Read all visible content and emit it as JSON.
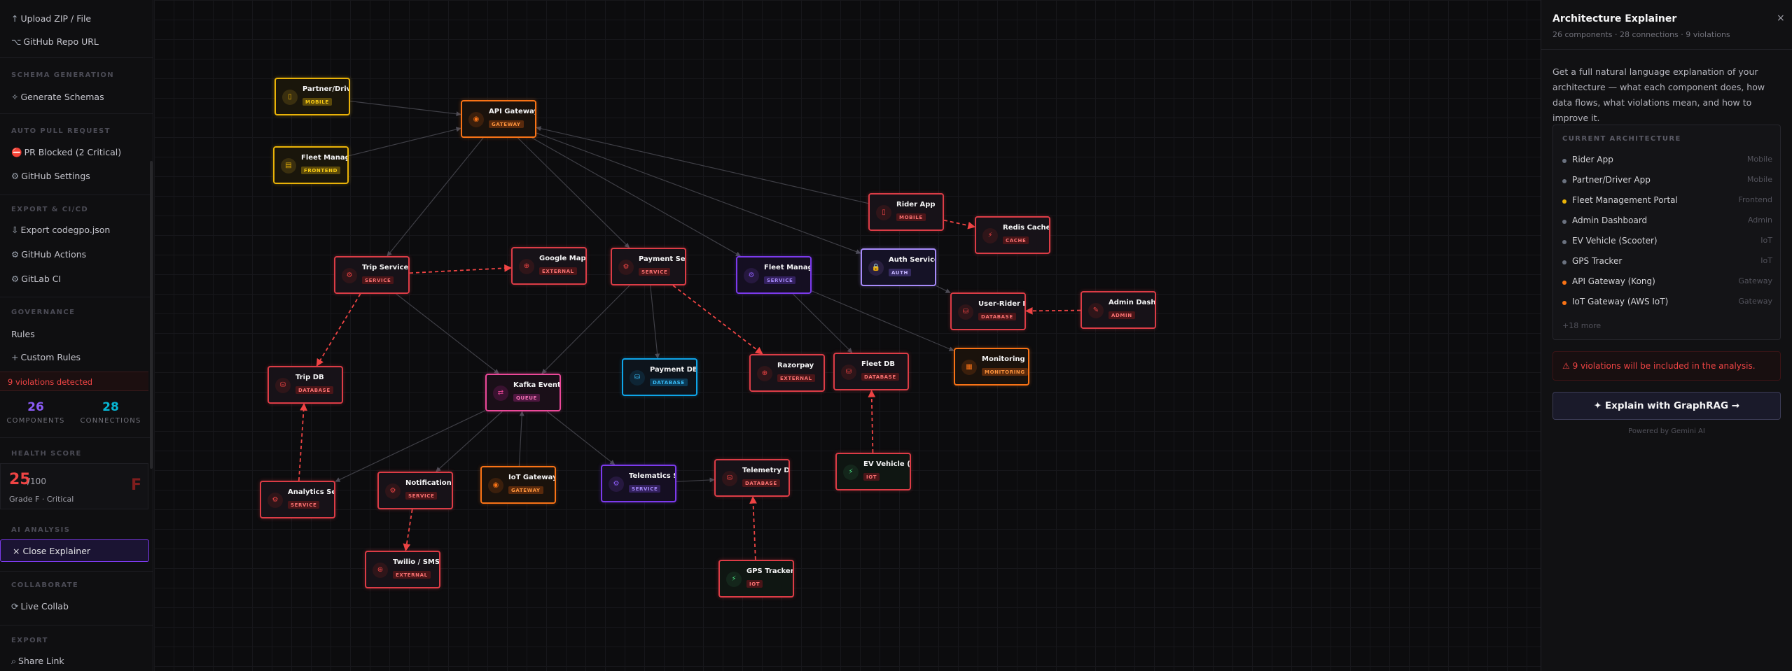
{
  "sidebar": {
    "items": {
      "upload": {
        "glyph": "↑",
        "label": "Upload ZIP / File"
      },
      "github_repo": {
        "glyph": "⌥",
        "label": "GitHub Repo URL"
      },
      "generate_schemas": {
        "glyph": "✧",
        "label": "Generate Schemas"
      },
      "pr_blocked": {
        "glyph": "⛔",
        "label": "PR Blocked (2 Critical)"
      },
      "github_settings": {
        "glyph": "⚙",
        "label": "GitHub Settings"
      },
      "export_json": {
        "glyph": "⇩",
        "label": "Export codegpo.json"
      },
      "github_actions": {
        "glyph": "⚙",
        "label": "GitHub Actions"
      },
      "gitlab_ci": {
        "glyph": "⚙",
        "label": "GitLab CI"
      },
      "rules": {
        "glyph": "",
        "label": "Rules"
      },
      "custom_rules": {
        "glyph": "+",
        "label": "Custom Rules"
      },
      "live_collab": {
        "glyph": "⟳",
        "label": "Live Collab"
      },
      "share_link": {
        "glyph": "⌕",
        "label": "Share Link"
      }
    },
    "sections": {
      "schema": "SCHEMA GENERATION",
      "auto_pr": "AUTO PULL REQUEST",
      "export_ci": "EXPORT & CI/CD",
      "governance": "GOVERNANCE",
      "health": "HEALTH SCORE",
      "ai": "AI ANALYSIS",
      "collab": "COLLABORATE",
      "export": "EXPORT"
    },
    "violations_text": "9 violations detected",
    "stats": {
      "components_value": "26",
      "components_label": "COMPONENTS",
      "connections_value": "28",
      "connections_label": "CONNECTIONS"
    },
    "health": {
      "score": "25",
      "of": "/100",
      "grade": "Grade F · Critical",
      "letter": "F"
    },
    "close_explainer": "× Close Explainer"
  },
  "canvas": {
    "nodes": [
      {
        "id": "partner",
        "name": "Partner/Driver…",
        "tag": "MOBILE",
        "icon": "▯",
        "kind": "yellow"
      },
      {
        "id": "fleetportal",
        "name": "Fleet Managem",
        "tag": "FRONTEND",
        "icon": "▤",
        "kind": "yellow"
      },
      {
        "id": "apigw",
        "name": "API Gateway (K",
        "tag": "GATEWAY",
        "icon": "◉",
        "kind": "orange"
      },
      {
        "id": "rider",
        "name": "Rider App",
        "tag": "MOBILE",
        "icon": "▯",
        "kind": "red"
      },
      {
        "id": "redis",
        "name": "Redis Cache",
        "tag": "CACHE",
        "icon": "⚡",
        "kind": "red"
      },
      {
        "id": "trip",
        "name": "Trip Service",
        "tag": "SERVICE",
        "icon": "⚙",
        "kind": "red"
      },
      {
        "id": "gmaps",
        "name": "Google Maps A",
        "tag": "EXTERNAL",
        "icon": "⊕",
        "kind": "red"
      },
      {
        "id": "payment",
        "name": "Payment Servi",
        "tag": "SERVICE",
        "icon": "⚙",
        "kind": "red"
      },
      {
        "id": "fleetsvc",
        "name": "Fleet Managem",
        "tag": "SERVICE",
        "icon": "⚙",
        "kind": "purple"
      },
      {
        "id": "auth",
        "name": "Auth Service",
        "tag": "AUTH",
        "icon": "🔒",
        "kind": "violet"
      },
      {
        "id": "userdb",
        "name": "User-Rider DB",
        "tag": "DATABASE",
        "icon": "⛁",
        "kind": "red"
      },
      {
        "id": "admin",
        "name": "Admin Dashboa",
        "tag": "ADMIN",
        "icon": "✎",
        "kind": "red"
      },
      {
        "id": "tripdb",
        "name": "Trip DB",
        "tag": "DATABASE",
        "icon": "⛁",
        "kind": "red"
      },
      {
        "id": "kafka",
        "name": "Kafka Event Bu",
        "tag": "QUEUE",
        "icon": "⇄",
        "kind": "pink"
      },
      {
        "id": "paydb",
        "name": "Payment DB",
        "tag": "DATABASE",
        "icon": "⛁",
        "kind": "blue"
      },
      {
        "id": "razorpay",
        "name": "Razorpay",
        "tag": "EXTERNAL",
        "icon": "⊕",
        "kind": "red"
      },
      {
        "id": "fleetdb",
        "name": "Fleet DB",
        "tag": "DATABASE",
        "icon": "⛁",
        "kind": "red"
      },
      {
        "id": "monitoring",
        "name": "Monitoring (Da",
        "tag": "MONITORING",
        "icon": "▦",
        "kind": "orange"
      },
      {
        "id": "analytics",
        "name": "Analytics Serv",
        "tag": "SERVICE",
        "icon": "⚙",
        "kind": "red"
      },
      {
        "id": "notif",
        "name": "Notification S",
        "tag": "SERVICE",
        "icon": "⚙",
        "kind": "red"
      },
      {
        "id": "iotgw",
        "name": "IoT Gateway (A",
        "tag": "GATEWAY",
        "icon": "◉",
        "kind": "orange"
      },
      {
        "id": "telemsvc",
        "name": "Telematics Ser",
        "tag": "SERVICE",
        "icon": "⚙",
        "kind": "purple"
      },
      {
        "id": "telemdb",
        "name": "Telemetry DB (",
        "tag": "DATABASE",
        "icon": "⛁",
        "kind": "red"
      },
      {
        "id": "ev",
        "name": "EV Vehicle (Sc",
        "tag": "IOT",
        "icon": "⚡",
        "kind": "green"
      },
      {
        "id": "twilio",
        "name": "Twilio / SMS",
        "tag": "EXTERNAL",
        "icon": "⊕",
        "kind": "red"
      },
      {
        "id": "gps",
        "name": "GPS Tracker",
        "tag": "IOT",
        "icon": "⚡",
        "kind": "green"
      }
    ]
  },
  "panel": {
    "title": "Architecture Explainer",
    "subtitle": "26 components · 28 connections · 9 violations",
    "close": "×",
    "description": "Get a full natural language explanation of your architecture — what each component does, how data flows, what violations mean, and how to improve it.",
    "card_heading": "CURRENT ARCHITECTURE",
    "components": [
      {
        "name": "Rider App",
        "type": "Mobile",
        "dot": "#6b7280"
      },
      {
        "name": "Partner/Driver App",
        "type": "Mobile",
        "dot": "#6b7280"
      },
      {
        "name": "Fleet Management Portal",
        "type": "Frontend",
        "dot": "#eab308"
      },
      {
        "name": "Admin Dashboard",
        "type": "Admin",
        "dot": "#6b7280"
      },
      {
        "name": "EV Vehicle (Scooter)",
        "type": "IoT",
        "dot": "#6b7280"
      },
      {
        "name": "GPS Tracker",
        "type": "IoT",
        "dot": "#6b7280"
      },
      {
        "name": "API Gateway (Kong)",
        "type": "Gateway",
        "dot": "#f97316"
      },
      {
        "name": "IoT Gateway (AWS IoT)",
        "type": "Gateway",
        "dot": "#f97316"
      }
    ],
    "more": "+18 more",
    "warning": "⚠ 9 violations will be included in the analysis.",
    "explain_button": "✦ Explain with GraphRAG →",
    "powered": "Powered by Gemini AI"
  }
}
